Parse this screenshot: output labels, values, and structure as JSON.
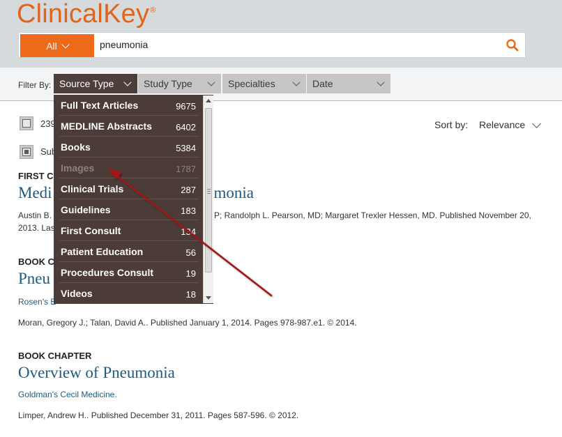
{
  "header": {
    "logo": "ClinicalKey",
    "logo_mark": "®",
    "search": {
      "scope_label": "All",
      "query": "pneumonia"
    }
  },
  "filters": {
    "label": "Filter By:",
    "dropdowns": [
      {
        "label": "Source Type"
      },
      {
        "label": "Study Type"
      },
      {
        "label": "Specialties"
      },
      {
        "label": "Date"
      }
    ]
  },
  "source_menu": {
    "items": [
      {
        "label": "Full Text Articles",
        "count": "9675"
      },
      {
        "label": "MEDLINE Abstracts",
        "count": "6402"
      },
      {
        "label": "Books",
        "count": "5384"
      },
      {
        "label": "Images",
        "count": "1787"
      },
      {
        "label": "Clinical Trials",
        "count": "287"
      },
      {
        "label": "Guidelines",
        "count": "183"
      },
      {
        "label": "First Consult",
        "count": "134"
      },
      {
        "label": "Patient Education",
        "count": "56"
      },
      {
        "label": "Procedures Consult",
        "count": "19"
      },
      {
        "label": "Videos",
        "count": "18"
      }
    ]
  },
  "results": {
    "count_partial": "239",
    "subscribed_partial": "Sub",
    "sort": {
      "label": "Sort by:",
      "value": "Relevance"
    },
    "items": [
      {
        "type": "FIRST C",
        "title_start": "Medi",
        "title_end": "umonia",
        "meta1_start": "Austin B.",
        "meta1_end": "P; Randolph L. Pearson, MD; Margaret Trexler Hessen, MD. Published November 20,",
        "meta2": "2013. Las"
      },
      {
        "type": "BOOK C",
        "title": "Pneu",
        "source": "Rosen's E",
        "meta": "Moran, Gregory J.; Talan, David A.. Published January 1, 2014. Pages 978-987.e1. © 2014."
      },
      {
        "type": "BOOK CHAPTER",
        "title": "Overview of Pneumonia",
        "source": "Goldman's Cecil Medicine.",
        "meta": "Limper, Andrew H.. Published December 31, 2011. Pages 587-596. © 2012."
      }
    ]
  },
  "colors": {
    "brand_orange": "#e1641b",
    "link_blue": "#1f5a80",
    "menu_bg": "#4b3c38",
    "annotation_arrow": "#a31818"
  }
}
